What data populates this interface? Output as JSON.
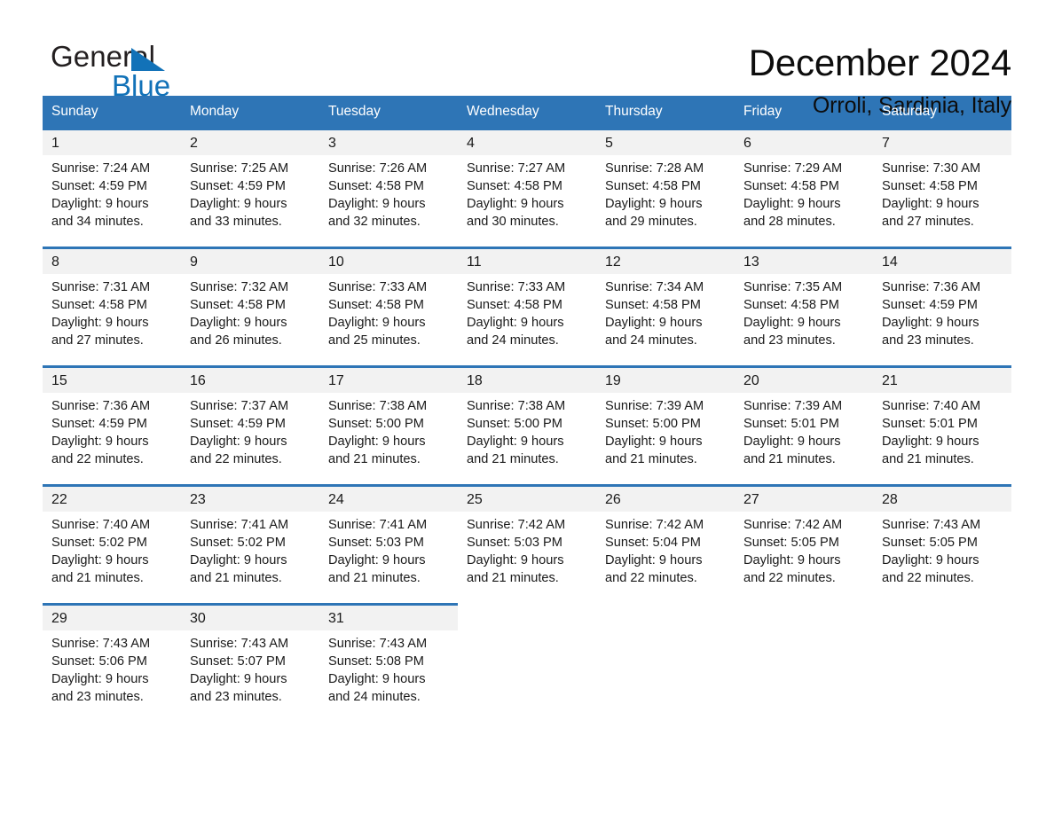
{
  "brand": {
    "name_part1": "General",
    "name_part2": "Blue",
    "triangle_color": "#1272b8",
    "text_color": "#231f20"
  },
  "header": {
    "title": "December 2024",
    "location": "Orroli, Sardinia, Italy"
  },
  "theme": {
    "header_blue": "#2e75b6",
    "daynum_bg": "#f2f2f2",
    "page_bg": "#ffffff"
  },
  "calendar": {
    "weekday_headers": [
      "Sunday",
      "Monday",
      "Tuesday",
      "Wednesday",
      "Thursday",
      "Friday",
      "Saturday"
    ],
    "weeks": [
      [
        {
          "day": "1",
          "sunrise": "Sunrise: 7:24 AM",
          "sunset": "Sunset: 4:59 PM",
          "daylight1": "Daylight: 9 hours",
          "daylight2": "and 34 minutes."
        },
        {
          "day": "2",
          "sunrise": "Sunrise: 7:25 AM",
          "sunset": "Sunset: 4:59 PM",
          "daylight1": "Daylight: 9 hours",
          "daylight2": "and 33 minutes."
        },
        {
          "day": "3",
          "sunrise": "Sunrise: 7:26 AM",
          "sunset": "Sunset: 4:58 PM",
          "daylight1": "Daylight: 9 hours",
          "daylight2": "and 32 minutes."
        },
        {
          "day": "4",
          "sunrise": "Sunrise: 7:27 AM",
          "sunset": "Sunset: 4:58 PM",
          "daylight1": "Daylight: 9 hours",
          "daylight2": "and 30 minutes."
        },
        {
          "day": "5",
          "sunrise": "Sunrise: 7:28 AM",
          "sunset": "Sunset: 4:58 PM",
          "daylight1": "Daylight: 9 hours",
          "daylight2": "and 29 minutes."
        },
        {
          "day": "6",
          "sunrise": "Sunrise: 7:29 AM",
          "sunset": "Sunset: 4:58 PM",
          "daylight1": "Daylight: 9 hours",
          "daylight2": "and 28 minutes."
        },
        {
          "day": "7",
          "sunrise": "Sunrise: 7:30 AM",
          "sunset": "Sunset: 4:58 PM",
          "daylight1": "Daylight: 9 hours",
          "daylight2": "and 27 minutes."
        }
      ],
      [
        {
          "day": "8",
          "sunrise": "Sunrise: 7:31 AM",
          "sunset": "Sunset: 4:58 PM",
          "daylight1": "Daylight: 9 hours",
          "daylight2": "and 27 minutes."
        },
        {
          "day": "9",
          "sunrise": "Sunrise: 7:32 AM",
          "sunset": "Sunset: 4:58 PM",
          "daylight1": "Daylight: 9 hours",
          "daylight2": "and 26 minutes."
        },
        {
          "day": "10",
          "sunrise": "Sunrise: 7:33 AM",
          "sunset": "Sunset: 4:58 PM",
          "daylight1": "Daylight: 9 hours",
          "daylight2": "and 25 minutes."
        },
        {
          "day": "11",
          "sunrise": "Sunrise: 7:33 AM",
          "sunset": "Sunset: 4:58 PM",
          "daylight1": "Daylight: 9 hours",
          "daylight2": "and 24 minutes."
        },
        {
          "day": "12",
          "sunrise": "Sunrise: 7:34 AM",
          "sunset": "Sunset: 4:58 PM",
          "daylight1": "Daylight: 9 hours",
          "daylight2": "and 24 minutes."
        },
        {
          "day": "13",
          "sunrise": "Sunrise: 7:35 AM",
          "sunset": "Sunset: 4:58 PM",
          "daylight1": "Daylight: 9 hours",
          "daylight2": "and 23 minutes."
        },
        {
          "day": "14",
          "sunrise": "Sunrise: 7:36 AM",
          "sunset": "Sunset: 4:59 PM",
          "daylight1": "Daylight: 9 hours",
          "daylight2": "and 23 minutes."
        }
      ],
      [
        {
          "day": "15",
          "sunrise": "Sunrise: 7:36 AM",
          "sunset": "Sunset: 4:59 PM",
          "daylight1": "Daylight: 9 hours",
          "daylight2": "and 22 minutes."
        },
        {
          "day": "16",
          "sunrise": "Sunrise: 7:37 AM",
          "sunset": "Sunset: 4:59 PM",
          "daylight1": "Daylight: 9 hours",
          "daylight2": "and 22 minutes."
        },
        {
          "day": "17",
          "sunrise": "Sunrise: 7:38 AM",
          "sunset": "Sunset: 5:00 PM",
          "daylight1": "Daylight: 9 hours",
          "daylight2": "and 21 minutes."
        },
        {
          "day": "18",
          "sunrise": "Sunrise: 7:38 AM",
          "sunset": "Sunset: 5:00 PM",
          "daylight1": "Daylight: 9 hours",
          "daylight2": "and 21 minutes."
        },
        {
          "day": "19",
          "sunrise": "Sunrise: 7:39 AM",
          "sunset": "Sunset: 5:00 PM",
          "daylight1": "Daylight: 9 hours",
          "daylight2": "and 21 minutes."
        },
        {
          "day": "20",
          "sunrise": "Sunrise: 7:39 AM",
          "sunset": "Sunset: 5:01 PM",
          "daylight1": "Daylight: 9 hours",
          "daylight2": "and 21 minutes."
        },
        {
          "day": "21",
          "sunrise": "Sunrise: 7:40 AM",
          "sunset": "Sunset: 5:01 PM",
          "daylight1": "Daylight: 9 hours",
          "daylight2": "and 21 minutes."
        }
      ],
      [
        {
          "day": "22",
          "sunrise": "Sunrise: 7:40 AM",
          "sunset": "Sunset: 5:02 PM",
          "daylight1": "Daylight: 9 hours",
          "daylight2": "and 21 minutes."
        },
        {
          "day": "23",
          "sunrise": "Sunrise: 7:41 AM",
          "sunset": "Sunset: 5:02 PM",
          "daylight1": "Daylight: 9 hours",
          "daylight2": "and 21 minutes."
        },
        {
          "day": "24",
          "sunrise": "Sunrise: 7:41 AM",
          "sunset": "Sunset: 5:03 PM",
          "daylight1": "Daylight: 9 hours",
          "daylight2": "and 21 minutes."
        },
        {
          "day": "25",
          "sunrise": "Sunrise: 7:42 AM",
          "sunset": "Sunset: 5:03 PM",
          "daylight1": "Daylight: 9 hours",
          "daylight2": "and 21 minutes."
        },
        {
          "day": "26",
          "sunrise": "Sunrise: 7:42 AM",
          "sunset": "Sunset: 5:04 PM",
          "daylight1": "Daylight: 9 hours",
          "daylight2": "and 22 minutes."
        },
        {
          "day": "27",
          "sunrise": "Sunrise: 7:42 AM",
          "sunset": "Sunset: 5:05 PM",
          "daylight1": "Daylight: 9 hours",
          "daylight2": "and 22 minutes."
        },
        {
          "day": "28",
          "sunrise": "Sunrise: 7:43 AM",
          "sunset": "Sunset: 5:05 PM",
          "daylight1": "Daylight: 9 hours",
          "daylight2": "and 22 minutes."
        }
      ],
      [
        {
          "day": "29",
          "sunrise": "Sunrise: 7:43 AM",
          "sunset": "Sunset: 5:06 PM",
          "daylight1": "Daylight: 9 hours",
          "daylight2": "and 23 minutes."
        },
        {
          "day": "30",
          "sunrise": "Sunrise: 7:43 AM",
          "sunset": "Sunset: 5:07 PM",
          "daylight1": "Daylight: 9 hours",
          "daylight2": "and 23 minutes."
        },
        {
          "day": "31",
          "sunrise": "Sunrise: 7:43 AM",
          "sunset": "Sunset: 5:08 PM",
          "daylight1": "Daylight: 9 hours",
          "daylight2": "and 24 minutes."
        },
        {
          "day": "",
          "sunrise": "",
          "sunset": "",
          "daylight1": "",
          "daylight2": ""
        },
        {
          "day": "",
          "sunrise": "",
          "sunset": "",
          "daylight1": "",
          "daylight2": ""
        },
        {
          "day": "",
          "sunrise": "",
          "sunset": "",
          "daylight1": "",
          "daylight2": ""
        },
        {
          "day": "",
          "sunrise": "",
          "sunset": "",
          "daylight1": "",
          "daylight2": ""
        }
      ]
    ]
  }
}
